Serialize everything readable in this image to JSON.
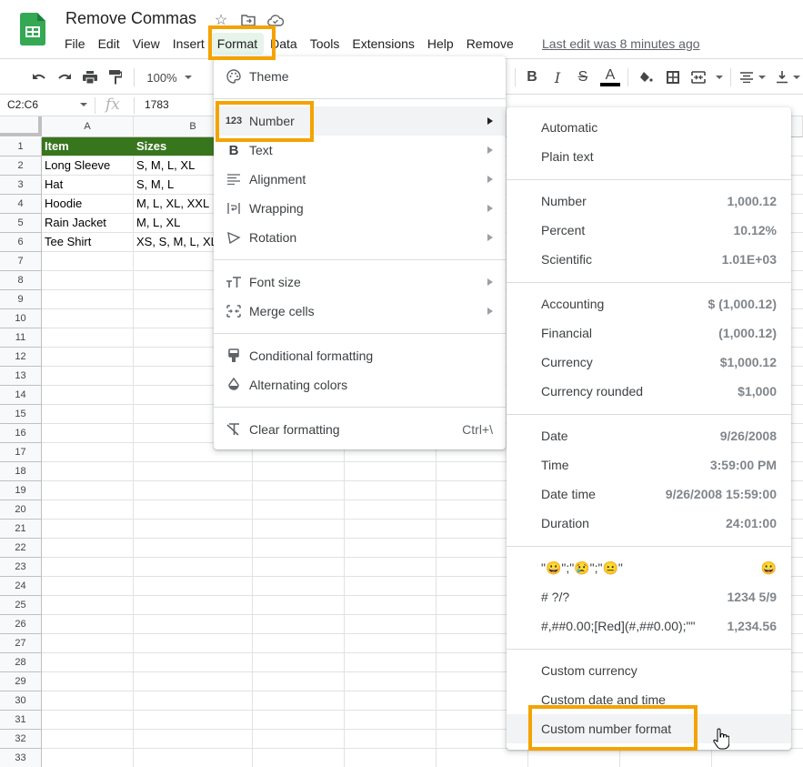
{
  "app": {
    "doc_title": "Remove Commas",
    "last_edit": "Last edit was 8 minutes ago",
    "menus": [
      "File",
      "Edit",
      "View",
      "Insert",
      "Format",
      "Data",
      "Tools",
      "Extensions",
      "Help",
      "Remove"
    ],
    "active_menu": "Format"
  },
  "toolbar": {
    "zoom": "100%",
    "icons": [
      "undo-icon",
      "redo-icon",
      "print-icon",
      "paint-format-icon",
      "bold-icon",
      "italic-icon",
      "strikethrough-icon",
      "text-color-icon",
      "fill-color-icon",
      "borders-icon",
      "merge-cells-icon",
      "horizontal-align-icon",
      "vertical-align-icon"
    ],
    "bold": "B",
    "italic": "I",
    "strike": "S",
    "text_color": "A"
  },
  "formula_bar": {
    "name_box": "C2:C6",
    "fx": "fx",
    "value": "1783"
  },
  "sheet": {
    "columns": [
      "A",
      "B"
    ],
    "rows": [
      "1",
      "2",
      "3",
      "4",
      "5",
      "6",
      "7",
      "8",
      "9",
      "10",
      "11",
      "12",
      "13",
      "14",
      "15",
      "16",
      "17",
      "18",
      "19",
      "20",
      "21",
      "22",
      "23",
      "24",
      "25",
      "26",
      "27",
      "28",
      "29",
      "30",
      "31",
      "32",
      "33"
    ],
    "header_row": [
      "Item",
      "Sizes"
    ],
    "data": [
      [
        "Long Sleeve",
        "S, M, L, XL"
      ],
      [
        "Hat",
        "S, M, L"
      ],
      [
        "Hoodie",
        "M, L, XL, XXL"
      ],
      [
        "Rain Jacket",
        "M, L, XL"
      ],
      [
        "Tee Shirt",
        "XS, S, M, L, XL"
      ]
    ],
    "header_color": "#38761d"
  },
  "format_menu": {
    "items": [
      {
        "label": "Theme",
        "icon": "palette-icon"
      },
      {
        "label": "Number",
        "icon": "number-123-icon",
        "submenu": true
      },
      {
        "label": "Text",
        "icon": "bold-b-icon",
        "submenu": true
      },
      {
        "label": "Alignment",
        "icon": "align-icon",
        "submenu": true
      },
      {
        "label": "Wrapping",
        "icon": "wrap-icon",
        "submenu": true
      },
      {
        "label": "Rotation",
        "icon": "rotation-icon",
        "submenu": true
      },
      {
        "label": "Font size",
        "icon": "font-size-icon",
        "submenu": true
      },
      {
        "label": "Merge cells",
        "icon": "merge-icon",
        "submenu": true
      },
      {
        "label": "Conditional formatting",
        "icon": "conditional-format-icon"
      },
      {
        "label": "Alternating colors",
        "icon": "alternating-colors-icon"
      },
      {
        "label": "Clear formatting",
        "icon": "clear-format-icon",
        "shortcut": "Ctrl+\\"
      }
    ],
    "icon_glyphs": {
      "number": "123",
      "text": "B"
    }
  },
  "number_menu": {
    "items": [
      {
        "label": "Automatic",
        "value": ""
      },
      {
        "label": "Plain text",
        "value": ""
      },
      {
        "label": "Number",
        "value": "1,000.12"
      },
      {
        "label": "Percent",
        "value": "10.12%"
      },
      {
        "label": "Scientific",
        "value": "1.01E+03"
      },
      {
        "label": "Accounting",
        "value": "$ (1,000.12)"
      },
      {
        "label": "Financial",
        "value": "(1,000.12)"
      },
      {
        "label": "Currency",
        "value": "$1,000.12"
      },
      {
        "label": "Currency rounded",
        "value": "$1,000"
      },
      {
        "label": "Date",
        "value": "9/26/2008"
      },
      {
        "label": "Time",
        "value": "3:59:00 PM"
      },
      {
        "label": "Date time",
        "value": "9/26/2008 15:59:00"
      },
      {
        "label": "Duration",
        "value": "24:01:00"
      },
      {
        "label": "\"😀\";\"😢\";\"😐\"",
        "value": "😀"
      },
      {
        "label": "# ?/?",
        "value": "1234 5/9"
      },
      {
        "label": "#,##0.00;[Red](#,##0.00);\"\"",
        "value": "1,234.56"
      },
      {
        "label": "Custom currency",
        "value": ""
      },
      {
        "label": "Custom date and time",
        "value": ""
      },
      {
        "label": "Custom number format",
        "value": ""
      }
    ]
  },
  "highlight_color": "#f4a300"
}
